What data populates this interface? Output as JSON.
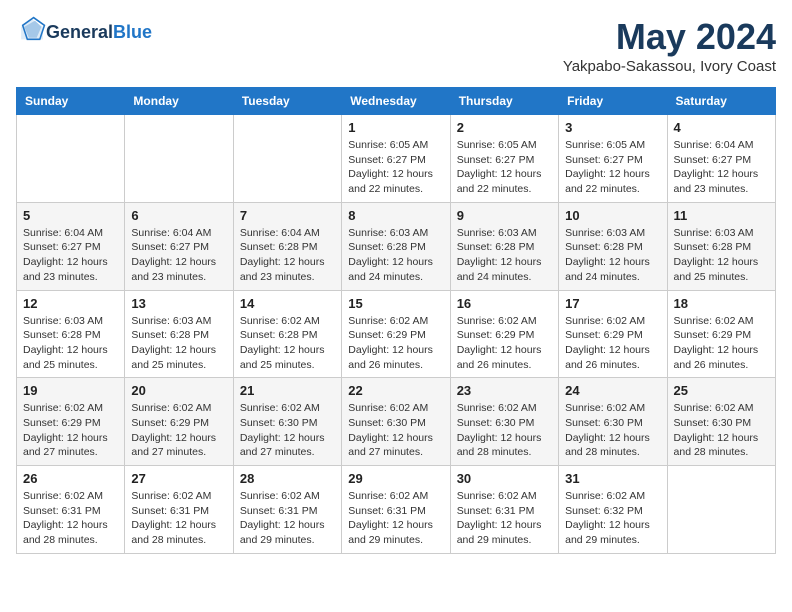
{
  "header": {
    "logo_general": "General",
    "logo_blue": "Blue",
    "month_title": "May 2024",
    "location": "Yakpabo-Sakassou, Ivory Coast"
  },
  "weekdays": [
    "Sunday",
    "Monday",
    "Tuesday",
    "Wednesday",
    "Thursday",
    "Friday",
    "Saturday"
  ],
  "weeks": [
    [
      {
        "day": "",
        "info": ""
      },
      {
        "day": "",
        "info": ""
      },
      {
        "day": "",
        "info": ""
      },
      {
        "day": "1",
        "info": "Sunrise: 6:05 AM\nSunset: 6:27 PM\nDaylight: 12 hours\nand 22 minutes."
      },
      {
        "day": "2",
        "info": "Sunrise: 6:05 AM\nSunset: 6:27 PM\nDaylight: 12 hours\nand 22 minutes."
      },
      {
        "day": "3",
        "info": "Sunrise: 6:05 AM\nSunset: 6:27 PM\nDaylight: 12 hours\nand 22 minutes."
      },
      {
        "day": "4",
        "info": "Sunrise: 6:04 AM\nSunset: 6:27 PM\nDaylight: 12 hours\nand 23 minutes."
      }
    ],
    [
      {
        "day": "5",
        "info": "Sunrise: 6:04 AM\nSunset: 6:27 PM\nDaylight: 12 hours\nand 23 minutes."
      },
      {
        "day": "6",
        "info": "Sunrise: 6:04 AM\nSunset: 6:27 PM\nDaylight: 12 hours\nand 23 minutes."
      },
      {
        "day": "7",
        "info": "Sunrise: 6:04 AM\nSunset: 6:28 PM\nDaylight: 12 hours\nand 23 minutes."
      },
      {
        "day": "8",
        "info": "Sunrise: 6:03 AM\nSunset: 6:28 PM\nDaylight: 12 hours\nand 24 minutes."
      },
      {
        "day": "9",
        "info": "Sunrise: 6:03 AM\nSunset: 6:28 PM\nDaylight: 12 hours\nand 24 minutes."
      },
      {
        "day": "10",
        "info": "Sunrise: 6:03 AM\nSunset: 6:28 PM\nDaylight: 12 hours\nand 24 minutes."
      },
      {
        "day": "11",
        "info": "Sunrise: 6:03 AM\nSunset: 6:28 PM\nDaylight: 12 hours\nand 25 minutes."
      }
    ],
    [
      {
        "day": "12",
        "info": "Sunrise: 6:03 AM\nSunset: 6:28 PM\nDaylight: 12 hours\nand 25 minutes."
      },
      {
        "day": "13",
        "info": "Sunrise: 6:03 AM\nSunset: 6:28 PM\nDaylight: 12 hours\nand 25 minutes."
      },
      {
        "day": "14",
        "info": "Sunrise: 6:02 AM\nSunset: 6:28 PM\nDaylight: 12 hours\nand 25 minutes."
      },
      {
        "day": "15",
        "info": "Sunrise: 6:02 AM\nSunset: 6:29 PM\nDaylight: 12 hours\nand 26 minutes."
      },
      {
        "day": "16",
        "info": "Sunrise: 6:02 AM\nSunset: 6:29 PM\nDaylight: 12 hours\nand 26 minutes."
      },
      {
        "day": "17",
        "info": "Sunrise: 6:02 AM\nSunset: 6:29 PM\nDaylight: 12 hours\nand 26 minutes."
      },
      {
        "day": "18",
        "info": "Sunrise: 6:02 AM\nSunset: 6:29 PM\nDaylight: 12 hours\nand 26 minutes."
      }
    ],
    [
      {
        "day": "19",
        "info": "Sunrise: 6:02 AM\nSunset: 6:29 PM\nDaylight: 12 hours\nand 27 minutes."
      },
      {
        "day": "20",
        "info": "Sunrise: 6:02 AM\nSunset: 6:29 PM\nDaylight: 12 hours\nand 27 minutes."
      },
      {
        "day": "21",
        "info": "Sunrise: 6:02 AM\nSunset: 6:30 PM\nDaylight: 12 hours\nand 27 minutes."
      },
      {
        "day": "22",
        "info": "Sunrise: 6:02 AM\nSunset: 6:30 PM\nDaylight: 12 hours\nand 27 minutes."
      },
      {
        "day": "23",
        "info": "Sunrise: 6:02 AM\nSunset: 6:30 PM\nDaylight: 12 hours\nand 28 minutes."
      },
      {
        "day": "24",
        "info": "Sunrise: 6:02 AM\nSunset: 6:30 PM\nDaylight: 12 hours\nand 28 minutes."
      },
      {
        "day": "25",
        "info": "Sunrise: 6:02 AM\nSunset: 6:30 PM\nDaylight: 12 hours\nand 28 minutes."
      }
    ],
    [
      {
        "day": "26",
        "info": "Sunrise: 6:02 AM\nSunset: 6:31 PM\nDaylight: 12 hours\nand 28 minutes."
      },
      {
        "day": "27",
        "info": "Sunrise: 6:02 AM\nSunset: 6:31 PM\nDaylight: 12 hours\nand 28 minutes."
      },
      {
        "day": "28",
        "info": "Sunrise: 6:02 AM\nSunset: 6:31 PM\nDaylight: 12 hours\nand 29 minutes."
      },
      {
        "day": "29",
        "info": "Sunrise: 6:02 AM\nSunset: 6:31 PM\nDaylight: 12 hours\nand 29 minutes."
      },
      {
        "day": "30",
        "info": "Sunrise: 6:02 AM\nSunset: 6:31 PM\nDaylight: 12 hours\nand 29 minutes."
      },
      {
        "day": "31",
        "info": "Sunrise: 6:02 AM\nSunset: 6:32 PM\nDaylight: 12 hours\nand 29 minutes."
      },
      {
        "day": "",
        "info": ""
      }
    ]
  ]
}
